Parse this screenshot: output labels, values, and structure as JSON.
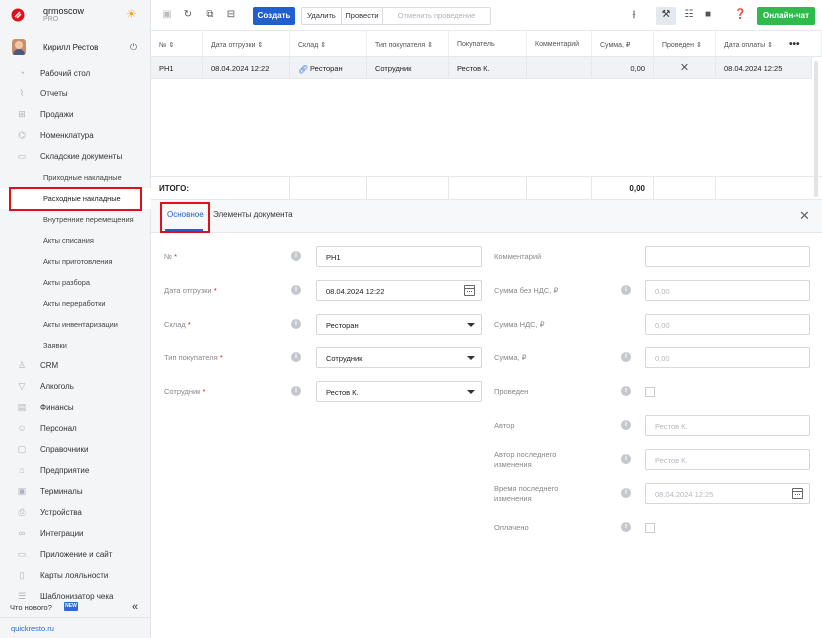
{
  "sidebar": {
    "account": {
      "name": "qrmoscow",
      "plan": "PRO"
    },
    "user": {
      "name": "Кирилл Рестов"
    },
    "nav": [
      {
        "label": "Рабочий стол",
        "icon": "dashboard-icon"
      },
      {
        "label": "Отчеты",
        "icon": "reports-icon"
      },
      {
        "label": "Продажи",
        "icon": "sales-icon"
      },
      {
        "label": "Номенклатура",
        "icon": "nomenclature-icon"
      },
      {
        "label": "Складские документы",
        "icon": "warehouse-docs-icon"
      }
    ],
    "sub": [
      {
        "label": "Приходные накладные"
      },
      {
        "label": "Расходные накладные"
      },
      {
        "label": "Внутренние перемещения"
      },
      {
        "label": "Акты списания"
      },
      {
        "label": "Акты приготовления"
      },
      {
        "label": "Акты разбора"
      },
      {
        "label": "Акты переработки"
      },
      {
        "label": "Акты инвентаризации"
      },
      {
        "label": "Заявки"
      }
    ],
    "nav2": [
      {
        "label": "CRM",
        "icon": "crm-icon"
      },
      {
        "label": "Алкоголь",
        "icon": "alcohol-icon"
      },
      {
        "label": "Финансы",
        "icon": "finance-icon"
      },
      {
        "label": "Персонал",
        "icon": "staff-icon"
      },
      {
        "label": "Справочники",
        "icon": "directories-icon"
      },
      {
        "label": "Предприятие",
        "icon": "enterprise-icon"
      },
      {
        "label": "Терминалы",
        "icon": "terminals-icon"
      },
      {
        "label": "Устройства",
        "icon": "devices-icon"
      },
      {
        "label": "Интеграции",
        "icon": "integrations-icon"
      },
      {
        "label": "Приложение и сайт",
        "icon": "app-site-icon"
      },
      {
        "label": "Карты лояльности",
        "icon": "loyalty-cards-icon"
      },
      {
        "label": "Шаблонизатор чека",
        "icon": "receipt-template-icon"
      }
    ],
    "whats_new": "Что нового?",
    "new_badge": "NEW",
    "footer": "quickresto.ru"
  },
  "toolbar": {
    "create": "Создать",
    "delete": "Удалить",
    "post": "Провести",
    "unpost": "Отменить проведение",
    "chat": "Онлайн-чат"
  },
  "grid": {
    "columns": [
      "№ ⇕",
      "Дата отгрузки ⇕",
      "Склад ⇕",
      "Тип покупателя ⇕",
      "Покупатель",
      "Комментарий",
      "Сумма, ₽",
      "Проведен ⇕",
      "Дата оплаты ⇕"
    ],
    "row": {
      "number": "РН1",
      "ship_date": "08.04.2024 12:22",
      "warehouse": "Ресторан",
      "buyer_type": "Сотрудник",
      "buyer": "Рестов К.",
      "comment": "",
      "sum": "0,00",
      "posted": "✕",
      "pay_date": "08.04.2024 12:25"
    },
    "total_label": "ИТОГО:",
    "total_sum": "0,00"
  },
  "detail": {
    "tabs": [
      "Основное",
      "Элементы документа"
    ],
    "left": [
      {
        "label": "№",
        "value": "РН1",
        "type": "text"
      },
      {
        "label": "Дата отгрузки",
        "value": "08.04.2024 12:22",
        "type": "date"
      },
      {
        "label": "Склад",
        "value": "Ресторан",
        "type": "select"
      },
      {
        "label": "Тип покупателя",
        "value": "Сотрудник",
        "type": "select"
      },
      {
        "label": "Сотрудник",
        "value": "Рестов К.",
        "type": "select"
      }
    ],
    "right": {
      "comment": {
        "label": "Комментарий",
        "value": ""
      },
      "sum_no_vat": {
        "label": "Сумма без НДС, ₽",
        "value": "0,00"
      },
      "vat": {
        "label": "Сумма НДС, ₽",
        "value": "0,00"
      },
      "sum": {
        "label": "Сумма, ₽",
        "value": "0,00"
      },
      "posted": {
        "label": "Проведен"
      },
      "author": {
        "label": "Автор",
        "value": "Рестов К."
      },
      "last_author": {
        "label1": "Автор последнего",
        "label2": "изменения",
        "value": "Рестов К."
      },
      "last_time": {
        "label1": "Время последнего",
        "label2": "изменения",
        "value": "08.04.2024 12:25"
      },
      "paid": {
        "label": "Оплачено"
      }
    }
  }
}
